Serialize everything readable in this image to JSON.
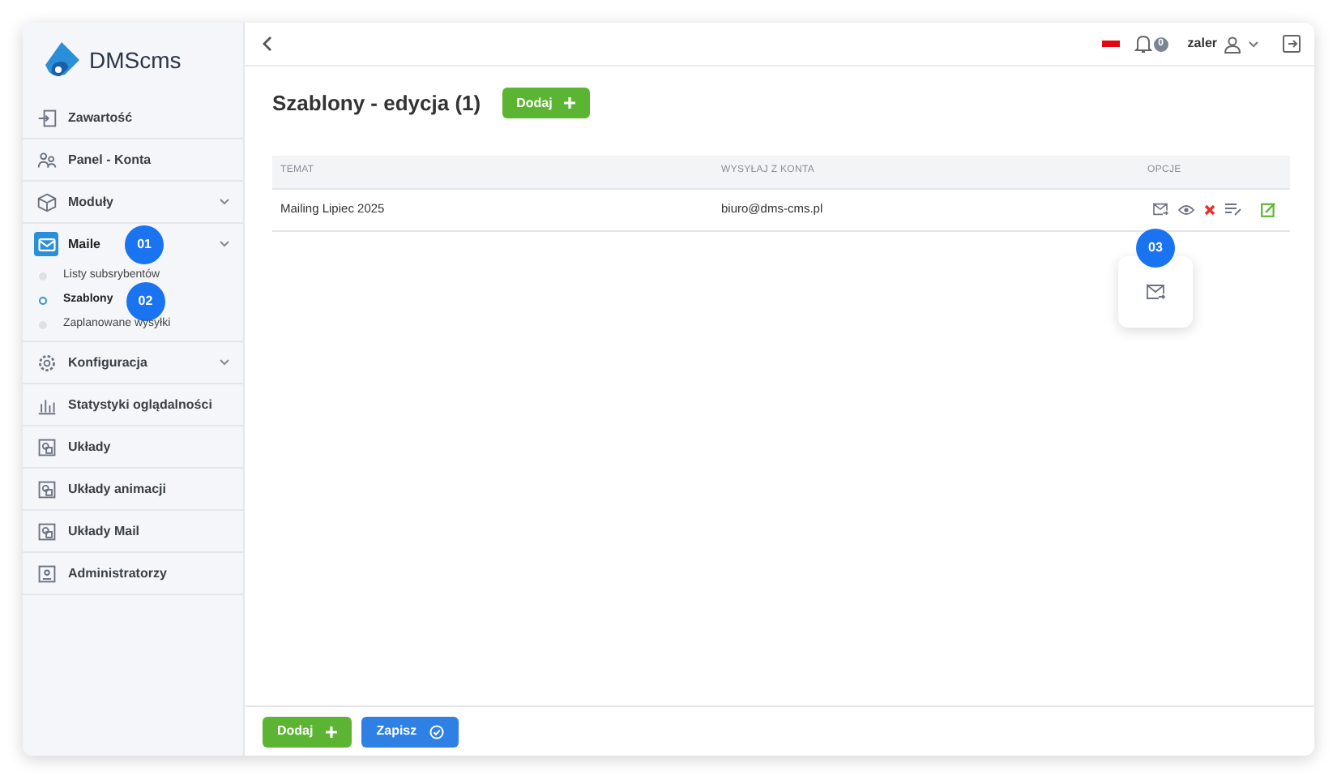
{
  "logo": {
    "text": "DMScms"
  },
  "sidebar": {
    "items": [
      {
        "label": "Zawartość",
        "kind": "link",
        "selected": false
      },
      {
        "label": "Panel - Konta",
        "kind": "link",
        "selected": false
      },
      {
        "label": "Moduły",
        "kind": "group",
        "selected": false
      },
      {
        "label": "Maile",
        "kind": "group",
        "selected": true,
        "expanded": true,
        "callout": "01",
        "children": [
          {
            "label": "Listy subsrybentów",
            "selected": false
          },
          {
            "label": "Szablony",
            "selected": true,
            "callout": "02"
          },
          {
            "label": "Zaplanowane wysyłki",
            "selected": false
          }
        ]
      },
      {
        "label": "Konfiguracja",
        "kind": "group",
        "selected": false
      },
      {
        "label": "Statystyki oglądalności",
        "kind": "link",
        "selected": false
      },
      {
        "label": "Układy",
        "kind": "link",
        "selected": false
      },
      {
        "label": "Układy animacji",
        "kind": "link",
        "selected": false
      },
      {
        "label": "Układy Mail",
        "kind": "link",
        "selected": false
      },
      {
        "label": "Administratorzy",
        "kind": "link",
        "selected": false
      }
    ]
  },
  "topbar": {
    "notifications": "0",
    "user": "zaler"
  },
  "page": {
    "title": "Szablony - edycja (1)",
    "add_button": "Dodaj"
  },
  "table": {
    "columns": [
      "TEMAT",
      "WYSYŁAJ Z KONTA",
      "OPCJE"
    ],
    "rows": [
      {
        "cells": [
          "Mailing Lipiec 2025",
          "biuro@dms-cms.pl"
        ]
      }
    ]
  },
  "popup": {
    "callout": "03"
  },
  "footer": {
    "buttons": [
      {
        "label": "Dodaj",
        "kind": "add"
      },
      {
        "label": "Zapisz",
        "kind": "save"
      }
    ]
  }
}
